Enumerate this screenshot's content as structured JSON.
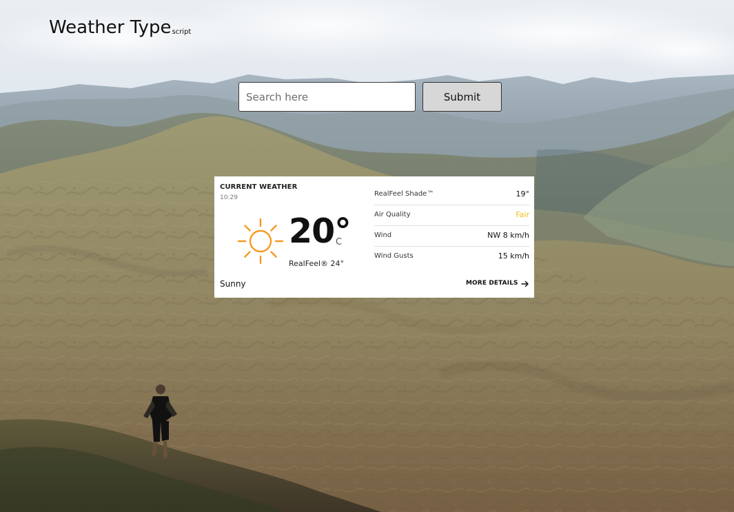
{
  "header": {
    "title": "Weather Type",
    "title_suffix": "script"
  },
  "search": {
    "placeholder": "Search here",
    "submit_label": "Submit"
  },
  "weather": {
    "section_title": "CURRENT WEATHER",
    "time": "10:29",
    "icon": "sun-icon",
    "temperature": "20°",
    "unit": "C",
    "realfeel": "RealFeel® 24°",
    "condition": "Sunny",
    "details": [
      {
        "label": "RealFeel Shade™",
        "value": "19°",
        "color": "#111111"
      },
      {
        "label": "Air Quality",
        "value": "Fair",
        "color": "#f2bd15"
      },
      {
        "label": "Wind",
        "value": "NW 8 km/h",
        "color": "#111111"
      },
      {
        "label": "Wind Gusts",
        "value": "15 km/h",
        "color": "#111111"
      }
    ],
    "more_details_label": "MORE DETAILS",
    "more_details_icon": "arrow-right-icon"
  },
  "colors": {
    "sun": "#f59a23",
    "air_quality_fair": "#f2bd15",
    "submit_bg": "#d7d7d7"
  }
}
